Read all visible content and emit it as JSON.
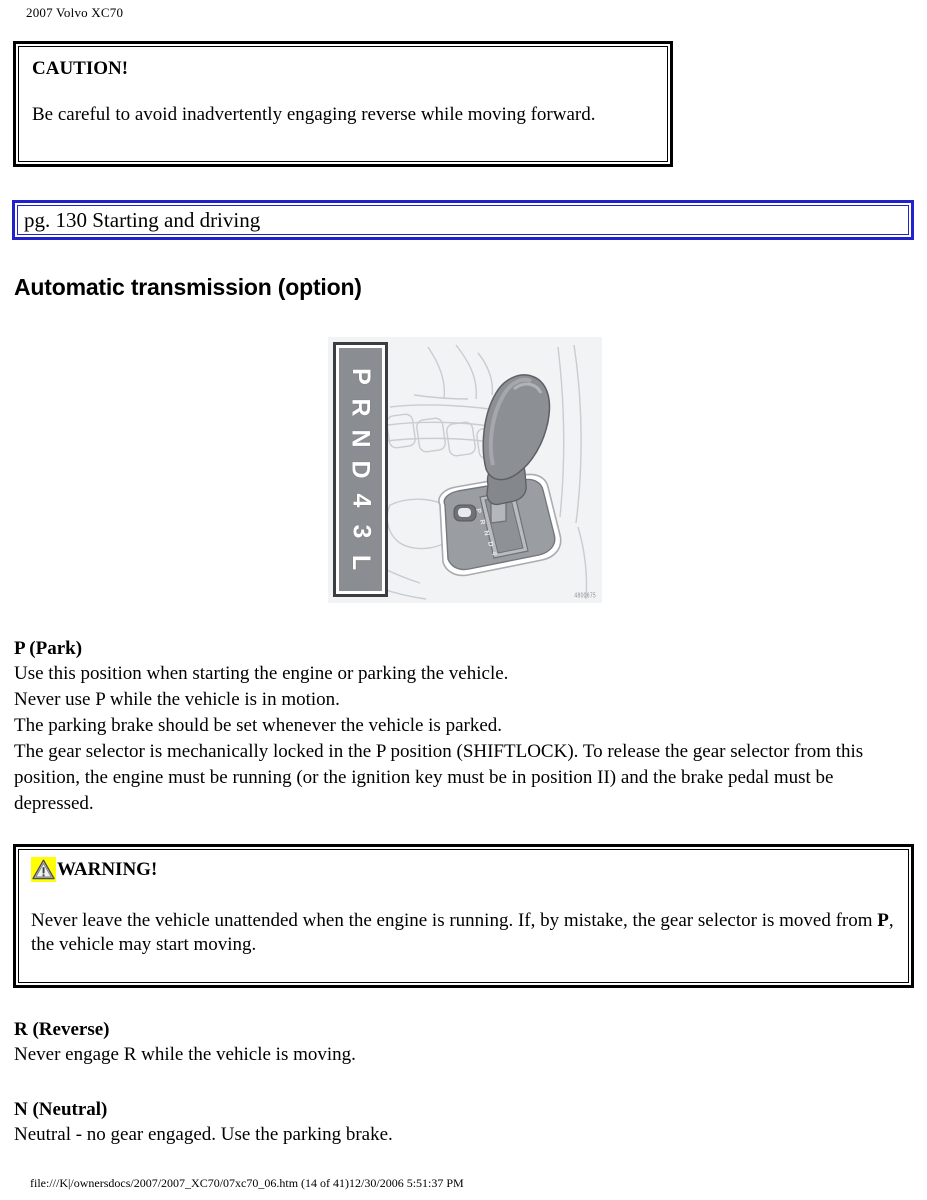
{
  "header": {
    "title": "2007 Volvo XC70"
  },
  "caution": {
    "title": "CAUTION!",
    "body": "Be careful to avoid inadvertently engaging reverse while moving forward."
  },
  "nav": {
    "label": "pg. 130 Starting and driving",
    "border_color": "#2222cc"
  },
  "section": {
    "heading": "Automatic transmission (option)"
  },
  "figure": {
    "name": "gear-selector-illustration",
    "gear_positions": [
      "P",
      "R",
      "N",
      "D",
      "4",
      "3",
      "L"
    ],
    "panel_color": "#8a8d91",
    "background_color": "#f2f3f4",
    "code_label": "4800675"
  },
  "park": {
    "heading": "P (Park)",
    "line1": "Use this position when starting the engine or parking the vehicle.",
    "line2": "Never use P while the vehicle is in motion.",
    "line3": "The parking brake should be set whenever the vehicle is parked.",
    "line4": "The gear selector is mechanically locked in the P position (SHIFTLOCK). To release the gear selector from this position, the engine must be running (or the ignition key must be in position II) and the brake pedal must be depressed."
  },
  "warning": {
    "title": "WARNING!",
    "icon": "warning-triangle-icon",
    "icon_background": "#ffff00",
    "body_part1": "Never leave the vehicle unattended when the engine is running. If, by mistake, the gear selector is moved from ",
    "body_bold": "P",
    "body_part2": ", the vehicle may start moving."
  },
  "reverse": {
    "heading": "R (Reverse)",
    "line1": "Never engage R while the vehicle is moving."
  },
  "neutral": {
    "heading": "N (Neutral)",
    "line1": "Neutral - no gear engaged. Use the parking brake."
  },
  "footer": {
    "text": "file:///K|/ownersdocs/2007/2007_XC70/07xc70_06.htm (14 of 41)12/30/2006 5:51:37 PM"
  }
}
